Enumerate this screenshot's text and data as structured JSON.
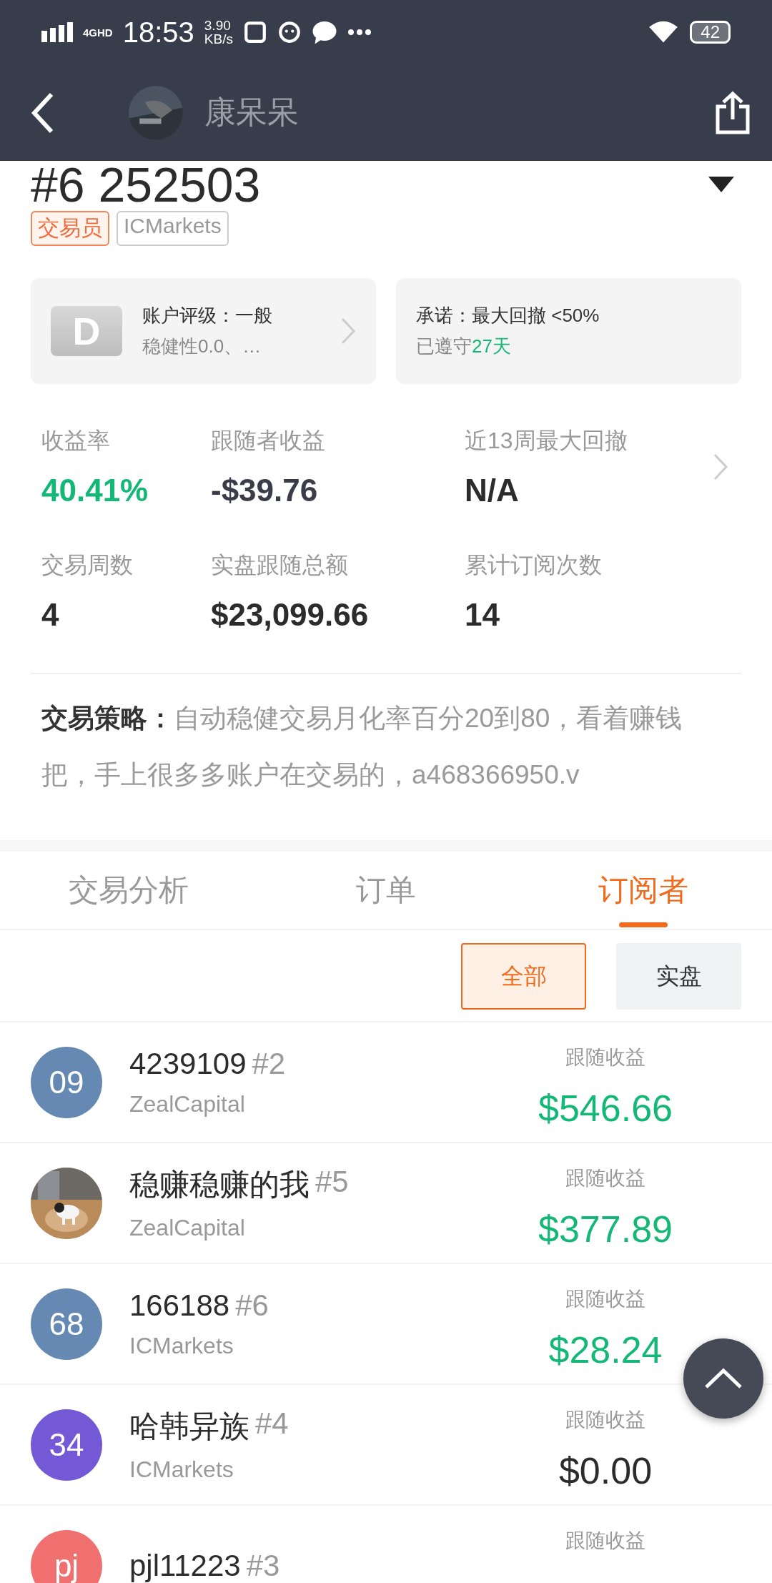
{
  "status_bar": {
    "network": "4GHD",
    "time": "18:53",
    "speed": "3.90",
    "speed_unit": "KB/s",
    "battery": "42"
  },
  "header": {
    "title": "康呆呆"
  },
  "account": {
    "title": "#6 252503",
    "tags": [
      {
        "label": "交易员",
        "kind": "role"
      },
      {
        "label": "ICMarkets",
        "kind": "broker"
      }
    ]
  },
  "rating_card": {
    "grade": "D",
    "title": "账户评级：一般",
    "subtitle": "稳健性0.0、…"
  },
  "promise_card": {
    "title": "承诺：最大回撤 <50%",
    "kept_prefix": "已遵守",
    "kept_days": "27天"
  },
  "stat_rows": [
    {
      "has_arrow": true,
      "items": [
        {
          "label": "收益率",
          "value": "40.41%",
          "color": "#14b876"
        },
        {
          "label": "跟随者收益",
          "value": "-$39.76",
          "color": "#3a3d48"
        },
        {
          "label": "近13周最大回撤",
          "value": "N/A",
          "color": "#2c2c2c"
        }
      ]
    },
    {
      "has_arrow": false,
      "items": [
        {
          "label": "交易周数",
          "value": "4",
          "color": "#2c2c2c"
        },
        {
          "label": "实盘跟随总额",
          "value": "$23,099.66",
          "color": "#2c2c2c"
        },
        {
          "label": "累计订阅次数",
          "value": "14",
          "color": "#2c2c2c"
        }
      ]
    }
  ],
  "strategy": {
    "label": "交易策略：",
    "text": "自动稳健交易月化率百分20到80，看着赚钱把，手上很多多账户在交易的，a468366950.v"
  },
  "tabs": [
    {
      "label": "交易分析",
      "selected": false
    },
    {
      "label": "订单",
      "selected": false
    },
    {
      "label": "订阅者",
      "selected": true
    }
  ],
  "filters": [
    {
      "label": "全部",
      "selected": true
    },
    {
      "label": "实盘",
      "selected": false
    }
  ],
  "subscribers": [
    {
      "avatar": {
        "kind": "initials",
        "text": "09",
        "color": "#6689b3"
      },
      "name": "4239109",
      "rank": "#2",
      "broker": "ZealCapital",
      "profit_label": "跟随收益",
      "profit": "$546.66",
      "color": "#14b876"
    },
    {
      "name": "稳赚稳赚的我",
      "rank": "#5",
      "broker": "ZealCapital",
      "profit_label": "跟随收益",
      "profit": "$377.89",
      "color": "#14b876"
    },
    {
      "avatar": {
        "kind": "initials",
        "text": "68",
        "color": "#6689b3"
      },
      "name": "166188",
      "rank": "#6",
      "broker": "ICMarkets",
      "profit_label": "跟随收益",
      "profit": "$28.24",
      "color": "#14b876"
    },
    {
      "avatar": {
        "kind": "initials",
        "text": "34",
        "color": "#7359d6"
      },
      "name": "哈韩异族",
      "rank": "#4",
      "broker": "ICMarkets",
      "profit_label": "跟随收益",
      "profit": "$0.00",
      "color": "#2c2c2c"
    },
    {
      "avatar": {
        "kind": "initials",
        "text": "pj",
        "color": "#f07070"
      },
      "name": "pjl11223",
      "rank": "#3",
      "profit_label": "跟随收益"
    }
  ]
}
